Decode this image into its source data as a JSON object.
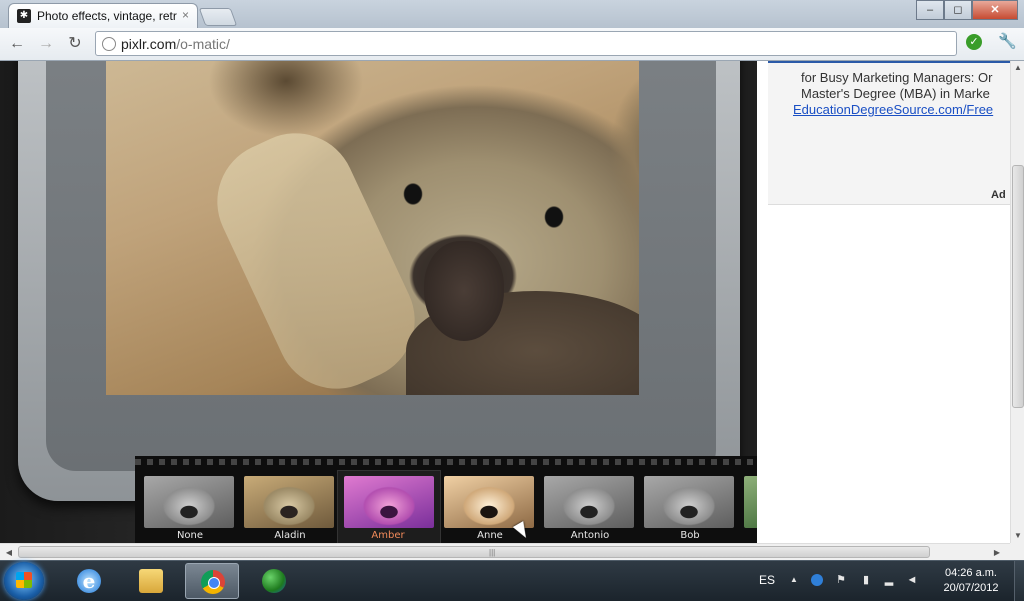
{
  "window": {
    "tab_title": "Photo effects, vintage, retro",
    "tab_close": "×",
    "buttons": {
      "minimize": "–",
      "maximize": "◻",
      "close": "✕"
    }
  },
  "toolbar": {
    "back": "←",
    "forward": "→",
    "reload": "↻",
    "url_host": "pixlr.com",
    "url_path": "/o-matic/",
    "wrench": "🔧",
    "ext": "✓"
  },
  "filters": [
    {
      "label": "None",
      "style": "gray",
      "selected": false
    },
    {
      "label": "Aladin",
      "style": "warm",
      "selected": false
    },
    {
      "label": "Amber",
      "style": "pink",
      "selected": true
    },
    {
      "label": "Anne",
      "style": "bright",
      "selected": false
    },
    {
      "label": "Antonio",
      "style": "gray",
      "selected": false
    },
    {
      "label": "Bob",
      "style": "gray",
      "selected": false
    }
  ],
  "ad": {
    "line1": "for Busy Marketing Managers: Or",
    "line2": "Master's Degree (MBA) in Marke",
    "link": "EducationDegreeSource.com/Free",
    "label": "Ad"
  },
  "scrollbars": {
    "up": "▲",
    "down": "▼",
    "left": "◀",
    "right": "▶",
    "grip": "|||"
  },
  "taskbar": {
    "language": "ES",
    "tray_up": "▲",
    "time": "04:26 a.m.",
    "date": "20/07/2012"
  },
  "colors": {
    "accent_link": "#1a4fc4",
    "selected_filter_label": "#f08a5a"
  }
}
